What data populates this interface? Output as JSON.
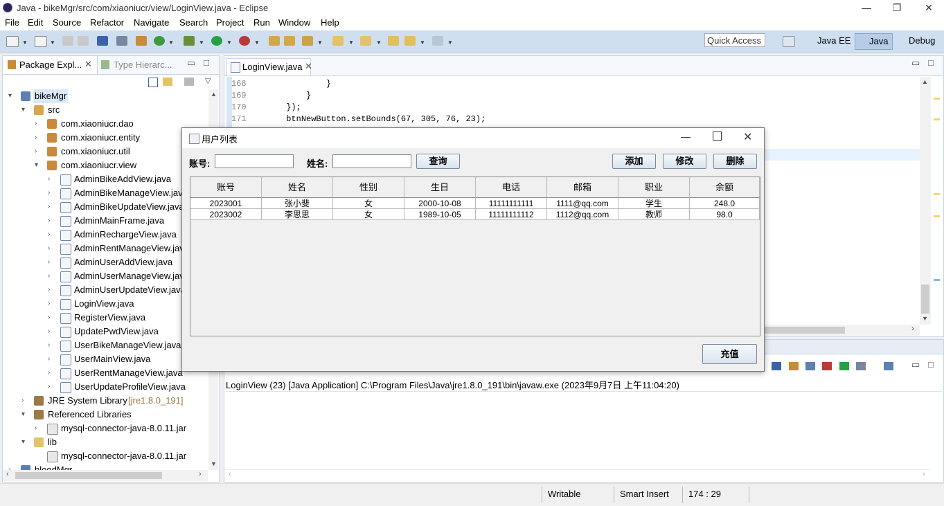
{
  "window": {
    "title": "Java - bikeMgr/src/com/xiaoniucr/view/LoginView.java - Eclipse"
  },
  "menu": [
    "File",
    "Edit",
    "Source",
    "Refactor",
    "Navigate",
    "Search",
    "Project",
    "Run",
    "Window",
    "Help"
  ],
  "toolbar": {
    "quick_access": "Quick Access",
    "perspectives": [
      "Java EE",
      "Java",
      "Debug"
    ]
  },
  "left": {
    "tabs": [
      "Package Expl...",
      "Type Hierarc..."
    ],
    "tree": [
      {
        "label": "bikeMgr",
        "icon": "project-icon"
      },
      {
        "label": "src",
        "icon": "source-folder-icon"
      },
      {
        "label": "com.xiaoniucr.dao",
        "icon": "package-icon"
      },
      {
        "label": "com.xiaoniucr.entity",
        "icon": "package-icon"
      },
      {
        "label": "com.xiaoniucr.util",
        "icon": "package-icon"
      },
      {
        "label": "com.xiaoniucr.view",
        "icon": "package-icon"
      },
      {
        "label": "AdminBikeAddView.java",
        "icon": "java-file-icon"
      },
      {
        "label": "AdminBikeManageView.java",
        "icon": "java-file-icon"
      },
      {
        "label": "AdminBikeUpdateView.java",
        "icon": "java-file-icon"
      },
      {
        "label": "AdminMainFrame.java",
        "icon": "java-file-icon"
      },
      {
        "label": "AdminRechargeView.java",
        "icon": "java-file-icon"
      },
      {
        "label": "AdminRentManageView.java",
        "icon": "java-file-icon"
      },
      {
        "label": "AdminUserAddView.java",
        "icon": "java-file-icon"
      },
      {
        "label": "AdminUserManageView.java",
        "icon": "java-file-icon"
      },
      {
        "label": "AdminUserUpdateView.java",
        "icon": "java-file-icon"
      },
      {
        "label": "LoginView.java",
        "icon": "java-file-icon"
      },
      {
        "label": "RegisterView.java",
        "icon": "java-file-icon"
      },
      {
        "label": "UpdatePwdView.java",
        "icon": "java-file-icon"
      },
      {
        "label": "UserBikeManageView.java",
        "icon": "java-file-icon"
      },
      {
        "label": "UserMainView.java",
        "icon": "java-file-icon"
      },
      {
        "label": "UserRentManageView.java",
        "icon": "java-file-icon"
      },
      {
        "label": "UserUpdateProfileView.java",
        "icon": "java-file-icon"
      },
      {
        "label": "JRE System Library",
        "suffix": "[jre1.8.0_191]",
        "icon": "library-icon"
      },
      {
        "label": "Referenced Libraries",
        "icon": "library-icon"
      },
      {
        "label": "mysql-connector-java-8.0.11.jar",
        "icon": "jar-icon"
      },
      {
        "label": "lib",
        "icon": "folder-icon"
      },
      {
        "label": "mysql-connector-java-8.0.11.jar",
        "icon": "jar-icon"
      },
      {
        "label": "bloodMgr",
        "icon": "project-icon"
      }
    ]
  },
  "editor": {
    "tab": "LoginView.java",
    "lines": [
      {
        "num": "168",
        "code": "                }"
      },
      {
        "num": "169",
        "code": "            }"
      },
      {
        "num": "170",
        "code": "        });"
      },
      {
        "num": "171",
        "code": "        btnNewButton.setBounds(67, 305, 76, 23);"
      }
    ]
  },
  "console": {
    "header": "LoginView (23) [Java Application] C:\\Program Files\\Java\\jre1.8.0_191\\bin\\javaw.exe (2023年9月7日 上午11:04:20)"
  },
  "status": {
    "writable": "Writable",
    "insert": "Smart Insert",
    "position": "174 : 29"
  },
  "dialog": {
    "title": "用户列表",
    "account_label": "账号:",
    "name_label": "姓名:",
    "query_button": "查询",
    "add_button": "添加",
    "edit_button": "修改",
    "delete_button": "删除",
    "recharge_button": "充值",
    "columns": [
      "账号",
      "姓名",
      "性别",
      "生日",
      "电话",
      "邮箱",
      "职业",
      "余额"
    ],
    "rows": [
      [
        "2023001",
        "张小斐",
        "女",
        "2000-10-08",
        "11111111111",
        "1111@qq.com",
        "学生",
        "248.0"
      ],
      [
        "2023002",
        "李思思",
        "女",
        "1989-10-05",
        "11111111112",
        "1112@qq.com",
        "教师",
        "98.0"
      ]
    ]
  }
}
